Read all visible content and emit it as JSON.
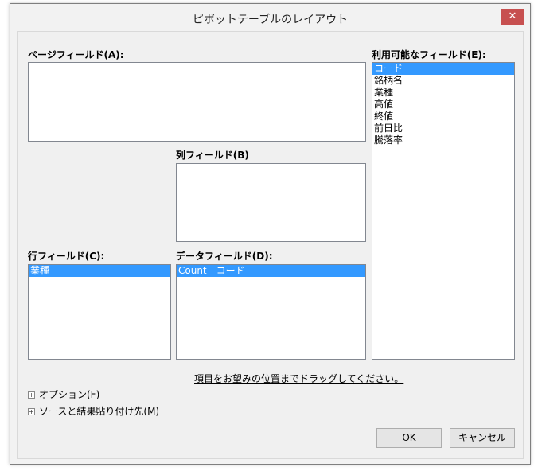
{
  "window": {
    "title": "ピボットテーブルのレイアウト",
    "close_label": "✕"
  },
  "labels": {
    "page_field": "ページフィールド(A):",
    "column_field": "列フィールド(B)",
    "row_field": "行フィールド(C):",
    "data_field": "データフィールド(D):",
    "available_fields": "利用可能なフィールド(E):"
  },
  "row_field_items": [
    "業種"
  ],
  "data_field_items": [
    "Count - コード"
  ],
  "available_fields_items": [
    "コード",
    "銘柄名",
    "業種",
    "高値",
    "終値",
    "前日比",
    "騰落率"
  ],
  "hint": "項目をお望みの位置までドラッグしてください。",
  "options_label": "オプション(F)",
  "source_label": "ソースと結果貼り付け先(M)",
  "buttons": {
    "ok": "OK",
    "cancel": "キャンセル"
  },
  "colors": {
    "selection": "#3399ff",
    "close": "#c75050"
  }
}
